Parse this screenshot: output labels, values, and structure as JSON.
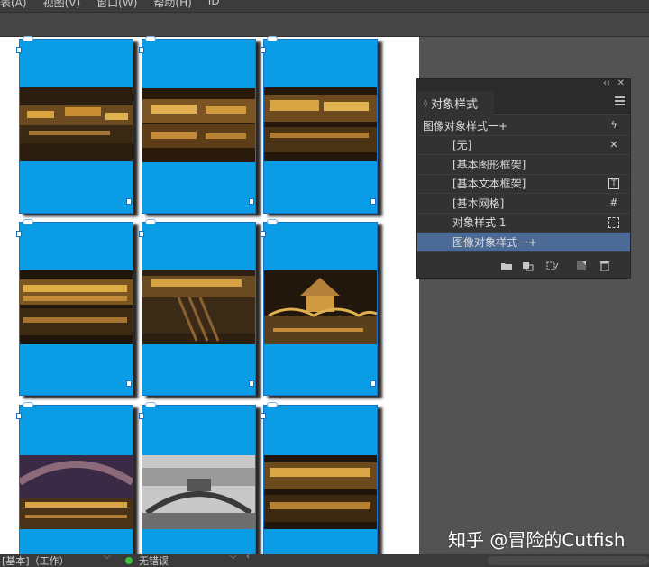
{
  "menubar": {
    "items": [
      "表(A)",
      "视图(V)",
      "窗口(W)",
      "帮助(H)",
      "ID"
    ]
  },
  "panel": {
    "tab_title": "对象样式",
    "rows": [
      {
        "label": "图像对象样式一+",
        "icon": "lightning-icon"
      },
      {
        "label": "[无]",
        "icon": "clear-overrides-icon"
      },
      {
        "label": "[基本图形框架]",
        "icon": ""
      },
      {
        "label": "[基本文本框架]",
        "icon": "text-frame-icon"
      },
      {
        "label": "[基本网格]",
        "icon": "grid-icon"
      },
      {
        "label": "对象样式 1",
        "icon": "frame-icon"
      },
      {
        "label": "图像对象样式一+",
        "icon": ""
      }
    ],
    "footer_icons": [
      "folder-icon",
      "new-style-from-selection-icon",
      "clear-attributes-icon",
      "new-style-icon",
      "trash-icon"
    ]
  },
  "status": {
    "page_style": "[基本]（工作）",
    "preflight": "无错误"
  },
  "watermark": "知乎 @冒险的Cutfish",
  "colors": {
    "frame_fill": "#0a9de6",
    "selection": "#4c6a96",
    "preflight_ok": "#3cbf3c"
  }
}
